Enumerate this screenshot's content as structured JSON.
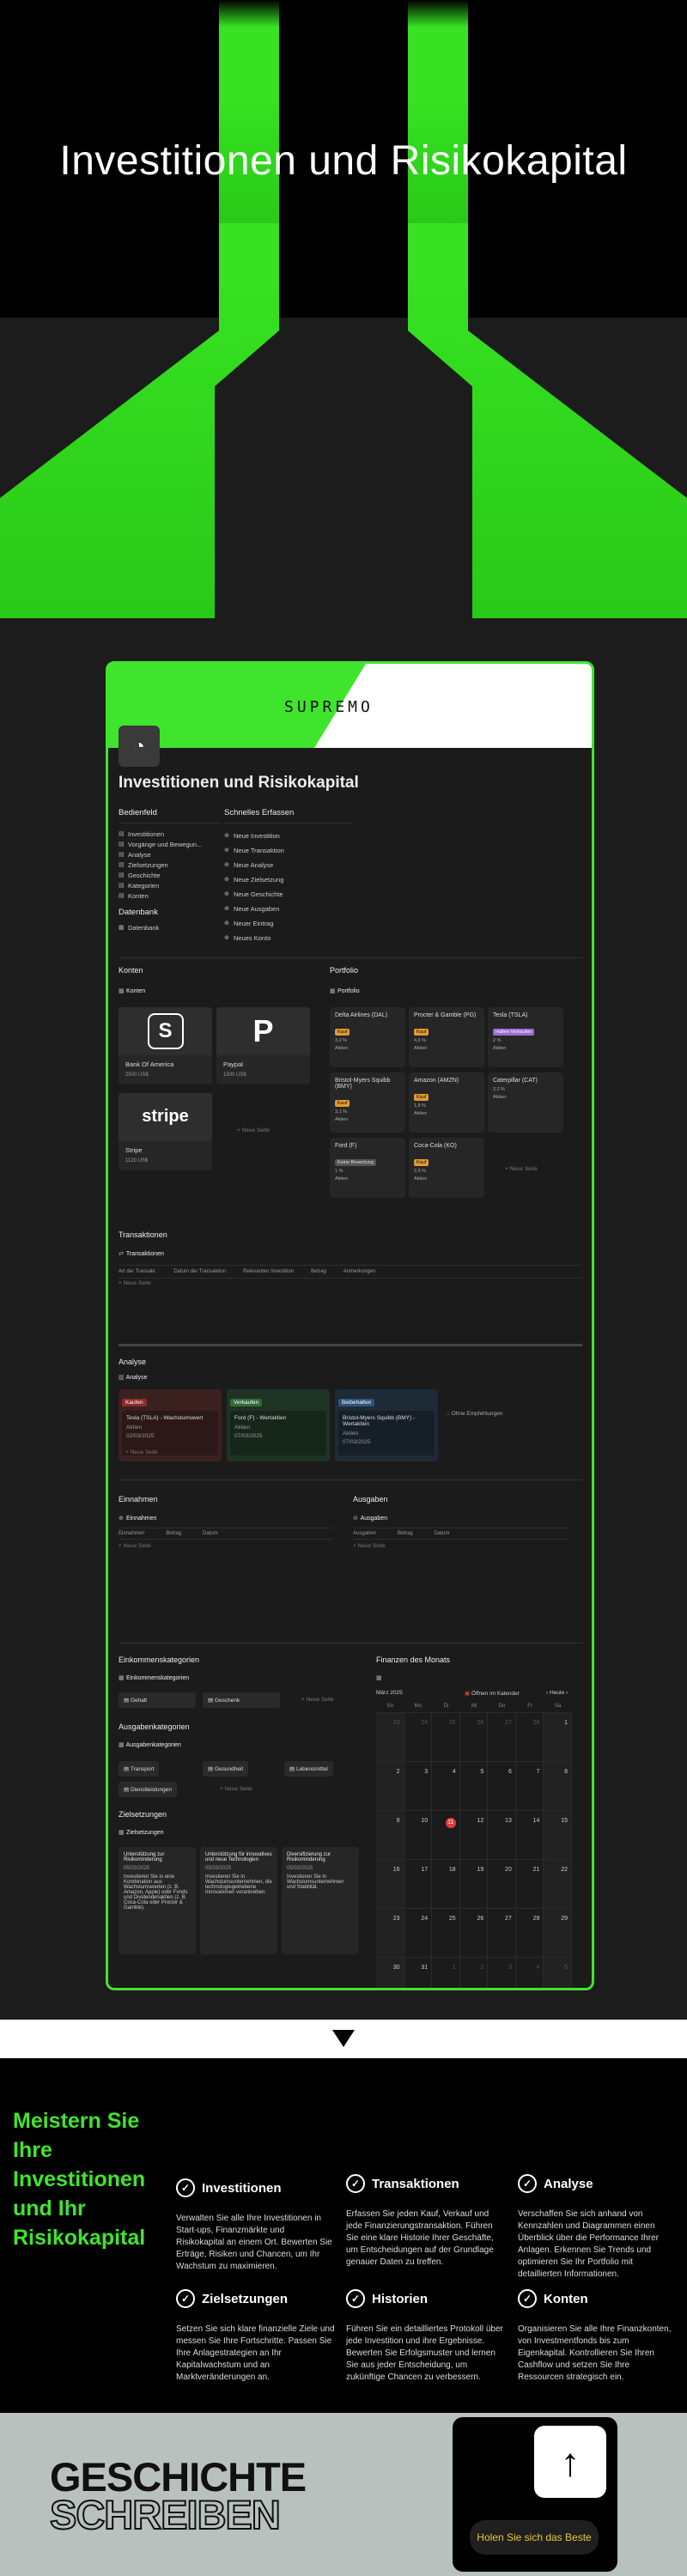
{
  "hero": {
    "title": "Investitionen und Risikokapital"
  },
  "frame": {
    "logo": "SUPREMO",
    "page_icon": "gauge-icon",
    "page_title": "Investitionen und Risikokapital",
    "bedienfeld": {
      "heading": "Bedienfeld",
      "items": [
        "Investitionen",
        "Vorgänge und Bewegun...",
        "Analyse",
        "Zielsetzungen",
        "Geschichte",
        "Kategorien",
        "Konten"
      ]
    },
    "datenbank": {
      "heading": "Datenbank",
      "items": [
        "Datenbank"
      ]
    },
    "schnell": {
      "heading": "Schnelles Erfassen",
      "items": [
        "Neue Investition",
        "Neue Transaktion",
        "Neue Analyse",
        "Neue Zielsetzung",
        "Neue Geschichte",
        "Neue Ausgaben",
        "Neuer Eintrag",
        "Neues Konto"
      ]
    },
    "konten": {
      "heading": "Konten",
      "view": "Konten",
      "cards": [
        {
          "name": "Bank Of America",
          "sub": "2500 US$",
          "logo": "S"
        },
        {
          "name": "Paypal",
          "sub": "1500 US$",
          "logo": "P"
        },
        {
          "name": "Stripe",
          "sub": "1120 US$",
          "logo": "stripe"
        }
      ],
      "new": "+ Neue Seite"
    },
    "portfolio": {
      "heading": "Portfolio",
      "view": "Portfolio",
      "cards": [
        {
          "name": "Delta Airlines (DAL)",
          "tag": "Kauf",
          "line1": "3,2 %",
          "line2": "Aktien"
        },
        {
          "name": "Procter & Gamble (PG)",
          "tag": "Kauf",
          "line1": "4,6 %",
          "line2": "Aktien"
        },
        {
          "name": "Tesla (TSLA)",
          "tag": "Halten Verkaufen",
          "line1": "2 %",
          "line2": "Aktien"
        },
        {
          "name": "Bristol-Myers Squibb (BMY)",
          "tag": "Kauf",
          "line1": "3,1 %",
          "line2": "Aktien"
        },
        {
          "name": "Amazon (AMZN)",
          "tag": "Kauf",
          "line1": "1,8 %",
          "line2": "Aktien"
        },
        {
          "name": "Caterpillar (CAT)",
          "tag": "",
          "line1": "2,2 %",
          "line2": "Aktien"
        },
        {
          "name": "Ford (F)",
          "tag": "Keine Bewertung",
          "line1": "1 %",
          "line2": "Aktien"
        },
        {
          "name": "Coca-Cola (KO)",
          "tag": "Kauf",
          "line1": "2,9 %",
          "line2": "Aktien"
        }
      ],
      "new": "+ Neue Seite"
    },
    "transaktionen": {
      "heading": "Transaktionen",
      "view": "Transaktionen",
      "columns": [
        "Art der Transakt.",
        "Datum der Transaktion",
        "Relevanten Investition",
        "Betrag",
        "Anmerkungen"
      ],
      "new": "+ Neue Seite"
    },
    "analyse": {
      "heading": "Analyse",
      "view": "Analyse",
      "columns": [
        {
          "tag": "Kaufen",
          "card": "Tesla (TSLA) - Wachstumswert",
          "sub": "Aktien",
          "date": "02/03/2025"
        },
        {
          "tag": "Verkaufen",
          "card": "Ford (F) - Wertaktien",
          "sub": "Aktien",
          "date": "07/03/2025"
        },
        {
          "tag": "Beibehalten",
          "card": "Bristol-Myers Squibb (BMY) - Wertaktien",
          "sub": "Aktien",
          "date": "07/03/2025"
        }
      ],
      "hidden": "Ohne Empfehlungen",
      "new": "+ Neue Seite"
    },
    "einnahmen": {
      "heading": "Einnahmen",
      "view": "Einnahmen",
      "columns": [
        "Einnahmen",
        "Betrag",
        "Datum"
      ],
      "new": "+ Neue Seite"
    },
    "ausgaben": {
      "heading": "Ausgaben",
      "view": "Ausgaben",
      "columns": [
        "Ausgaben",
        "Betrag",
        "Datum"
      ],
      "new": "+ Neue Seite"
    },
    "eink_kat": {
      "heading": "Einkommenskategorien",
      "view": "Einkommenskategorien",
      "items": [
        "Gehalt",
        "Geschenk"
      ],
      "new": "+ Neue Seite"
    },
    "ausg_kat": {
      "heading": "Ausgabenkategorien",
      "view": "Ausgabenkategorien",
      "items": [
        "Transport",
        "Gesundheit",
        "Lebensmittel",
        "Dienstleistungen"
      ],
      "new": "+ Neue Seite"
    },
    "ziele": {
      "heading": "Zielsetzungen",
      "view": "Zielsetzungen",
      "cards": [
        {
          "title": "Unterstützung zur Risikominderung",
          "date": "05/03/2025",
          "body": "Investieren Sie in eine Kombination aus Wachstumswerten (z. B. Amazon, Apple) oder Fonds und Dividendenaktien (z. B. Coca-Cola oder Procter & Gamble)."
        },
        {
          "title": "Unterstützung für innovatives und neue Technologien",
          "date": "05/03/2025",
          "body": "Investieren Sie in Wachstumsunternehmen, die technologiegetriebene Innovationen vorantreiben."
        },
        {
          "title": "Diversifizierung zur Risikominderung",
          "date": "05/03/2025",
          "body": "Investieren Sie in Wachstumsunternehmen und Stabilität."
        }
      ]
    },
    "finanzen": {
      "heading": "Finanzen des Monats",
      "month": "März 2025",
      "open_calendar": "Öffnen im Kalender",
      "today": "Heute",
      "weekdays": [
        "So",
        "Mo",
        "Di",
        "Mi",
        "Do",
        "Fr",
        "Sa"
      ],
      "weeks": [
        [
          "23",
          "24",
          "25",
          "26",
          "27",
          "28",
          "1"
        ],
        [
          "2",
          "3",
          "4",
          "5",
          "6",
          "7",
          "8"
        ],
        [
          "9",
          "10",
          "11",
          "12",
          "13",
          "14",
          "15"
        ],
        [
          "16",
          "17",
          "18",
          "19",
          "20",
          "21",
          "22"
        ],
        [
          "23",
          "24",
          "25",
          "26",
          "27",
          "28",
          "29"
        ],
        [
          "30",
          "31",
          "1",
          "2",
          "3",
          "4",
          "5"
        ]
      ]
    }
  },
  "features": {
    "title": "Meistern Sie Ihre Investitionen und Ihr Risikokapital",
    "items": [
      {
        "title": "Investitionen",
        "text": "Verwalten Sie alle Ihre Investitionen in Start-ups, Finanzmärkte und Risikokapital an einem Ort. Bewerten Sie Erträge, Risiken und Chancen, um Ihr Wachstum zu maximieren."
      },
      {
        "title": "Transaktionen",
        "text": "Erfassen Sie jeden Kauf, Verkauf und jede Finanzierungstransaktion. Führen Sie eine klare Historie Ihrer Geschäfte, um Entscheidungen auf der Grundlage genauer Daten zu treffen."
      },
      {
        "title": "Analyse",
        "text": "Verschaffen Sie sich anhand von Kennzahlen und Diagrammen einen Überblick über die Performance Ihrer Anlagen. Erkennen Sie Trends und optimieren Sie Ihr Portfolio mit detaillierten Informationen."
      },
      {
        "title": "Zielsetzungen",
        "text": "Setzen Sie sich klare finanzielle Ziele und messen Sie Ihre Fortschritte. Passen Sie Ihre Anlagestrategien an Ihr Kapitalwachstum und an Marktveränderungen an."
      },
      {
        "title": "Historien",
        "text": "Führen Sie ein detailliertes Protokoll über jede Investition und ihre Ergebnisse. Bewerten Sie Erfolgsmuster und lernen Sie aus jeder Entscheidung, um zukünftige Chancen zu verbessern."
      },
      {
        "title": "Konten",
        "text": "Organisieren Sie alle Ihre Finanzkonten, von Investmentfonds bis zum Eigenkapital. Kontrollieren Sie Ihren Cashflow und setzen Sie Ihre Ressourcen strategisch ein."
      }
    ]
  },
  "footer": {
    "line1": "GESCHICHTE",
    "line2": "SCHREIBEN",
    "cta_icon": "arrow-up-icon",
    "cta": "Holen Sie sich das Beste"
  },
  "colors": {
    "accent": "#3fe52c",
    "cta_text": "#e9c73b",
    "footer_bg": "#b9c1be"
  }
}
